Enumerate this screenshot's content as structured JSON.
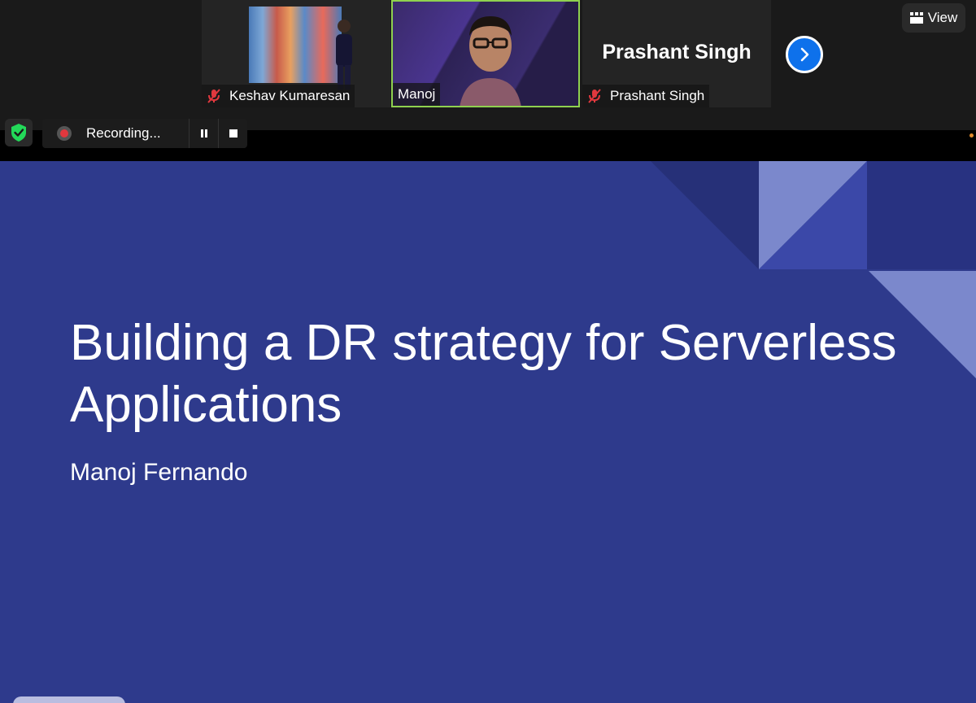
{
  "participants": [
    {
      "name": "Keshav Kumaresan",
      "muted": true,
      "display": "video"
    },
    {
      "name": "Manoj",
      "muted": false,
      "display": "video",
      "active_speaker": true
    },
    {
      "name": "Prashant Singh",
      "muted": true,
      "display": "name",
      "display_name": "Prashant Singh"
    }
  ],
  "toolbar": {
    "view_label": "View"
  },
  "recording": {
    "label": "Recording..."
  },
  "slide": {
    "title": "Building a DR strategy for Serverless Applications",
    "author": "Manoj Fernando"
  },
  "colors": {
    "slide_bg": "#2e3a8c",
    "active_speaker_border": "#8fd14f",
    "next_button": "#0e71eb",
    "muted_icon": "#e0383e",
    "security_shield": "#23d959"
  },
  "icons": {
    "muted": "mic-off-icon",
    "next": "chevron-right-icon",
    "view": "grid-icon",
    "security": "shield-check-icon",
    "record": "record-dot-icon",
    "pause": "pause-icon",
    "stop": "stop-icon"
  }
}
